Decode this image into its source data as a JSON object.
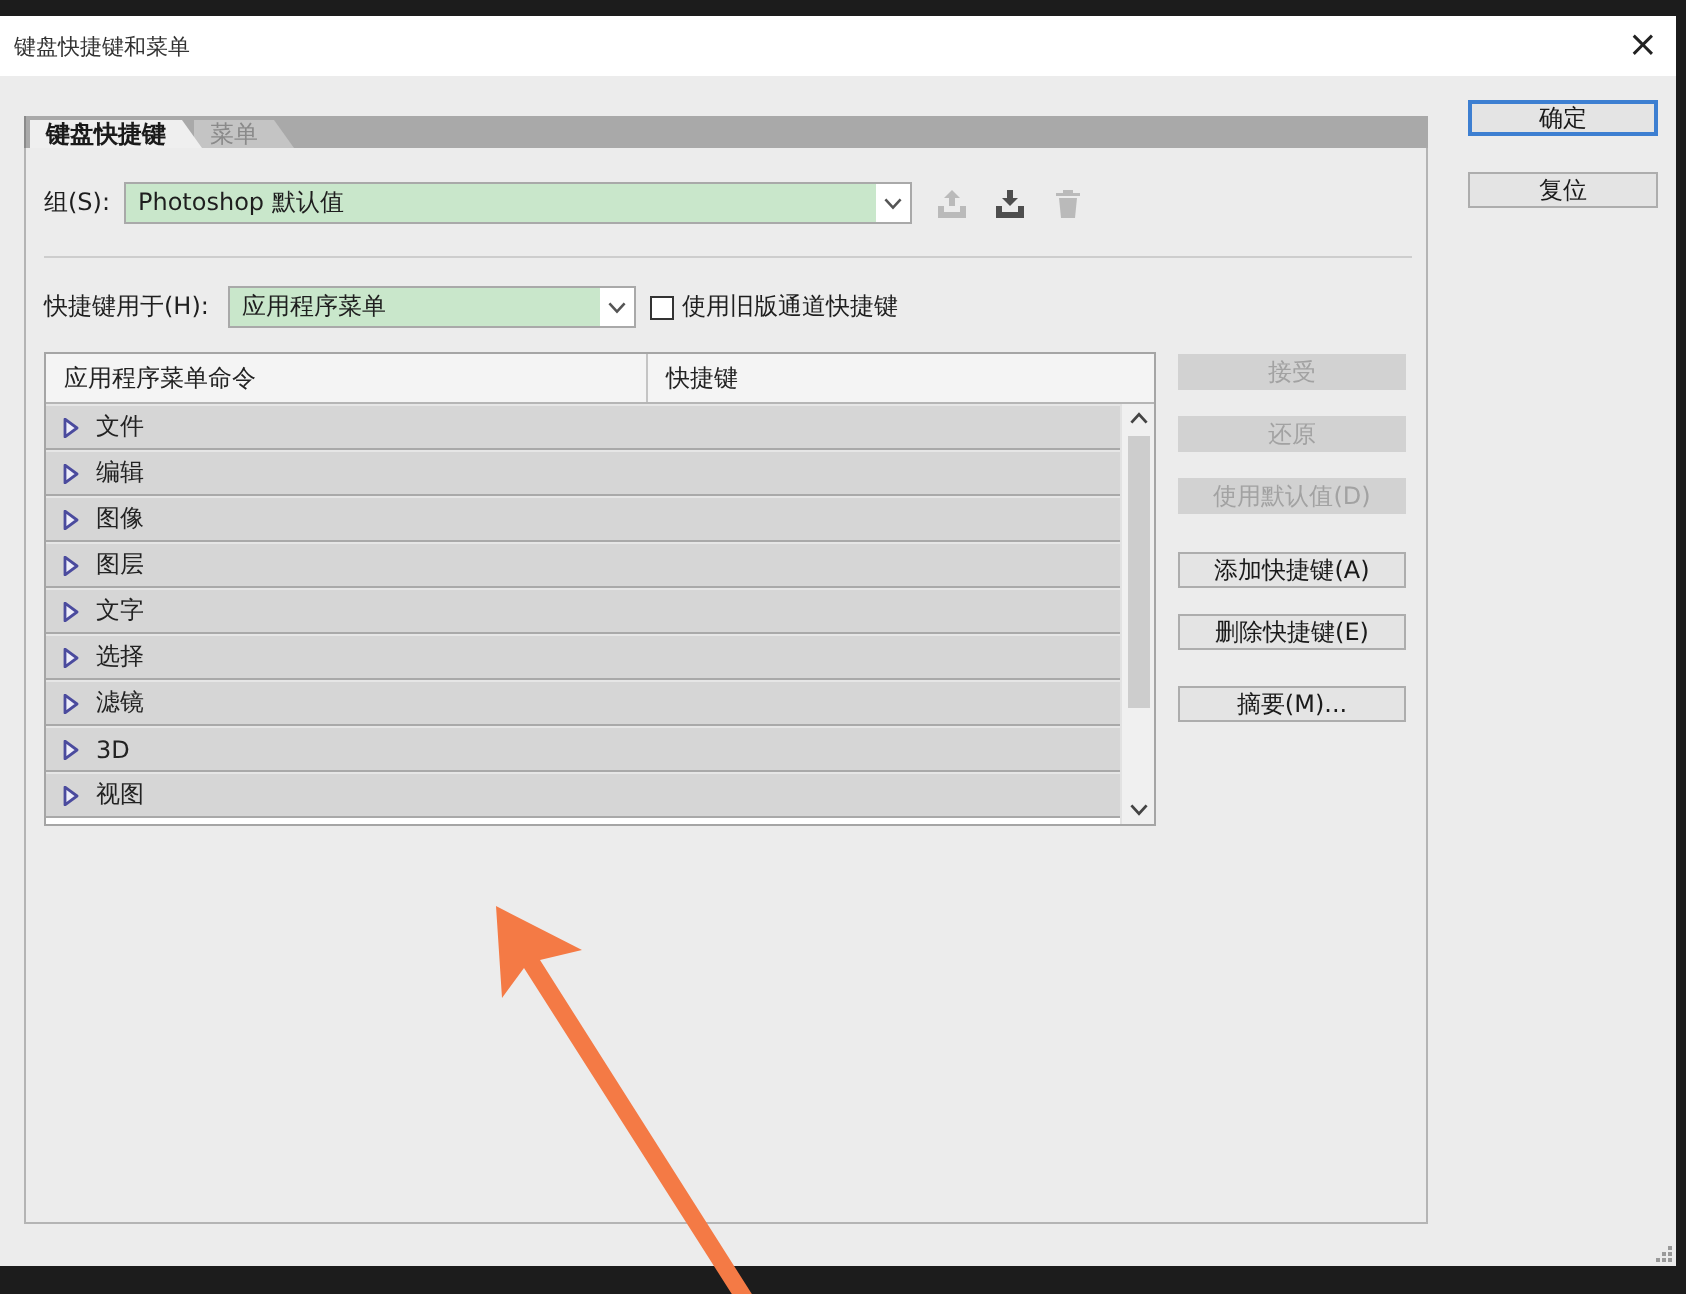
{
  "window": {
    "title": "键盘快捷键和菜单",
    "close": "×"
  },
  "tabs": [
    {
      "label": "键盘快捷键",
      "selected": true
    },
    {
      "label": "菜单",
      "selected": false
    }
  ],
  "group_selector": {
    "label": "组(S):",
    "value": "Photoshop 默认值",
    "actions": [
      {
        "kind": "save",
        "disabled": true
      },
      {
        "kind": "save-as",
        "disabled": false
      },
      {
        "kind": "delete",
        "disabled": true
      }
    ]
  },
  "shortcuts_for": {
    "label": "快捷键用于(H):",
    "value": "应用程序菜单"
  },
  "legacy_channel_shortcuts": {
    "label": "使用旧版通道快捷键",
    "checked": false
  },
  "table": {
    "columns": [
      "应用程序菜单命令",
      "快捷键"
    ],
    "rows": [
      {
        "command": "文件",
        "expanded": false
      },
      {
        "command": "编辑",
        "expanded": false
      },
      {
        "command": "图像",
        "expanded": false
      },
      {
        "command": "图层",
        "expanded": false
      },
      {
        "command": "文字",
        "expanded": false
      },
      {
        "command": "选择",
        "expanded": false
      },
      {
        "command": "滤镜",
        "expanded": false
      },
      {
        "command": "3D",
        "expanded": false
      },
      {
        "command": "视图",
        "expanded": false
      }
    ]
  },
  "side_buttons": [
    {
      "label": "接受",
      "disabled": true
    },
    {
      "label": "还原",
      "disabled": true
    },
    {
      "label": "使用默认值(D)",
      "disabled": true
    },
    {
      "label": "添加快捷键(A)",
      "disabled": false
    },
    {
      "label": "删除快捷键(E)",
      "disabled": false
    },
    {
      "label": "摘要(M)...",
      "disabled": false
    }
  ],
  "dialog_buttons": [
    {
      "label": "确定",
      "focused": true
    },
    {
      "label": "复位",
      "focused": false
    }
  ]
}
